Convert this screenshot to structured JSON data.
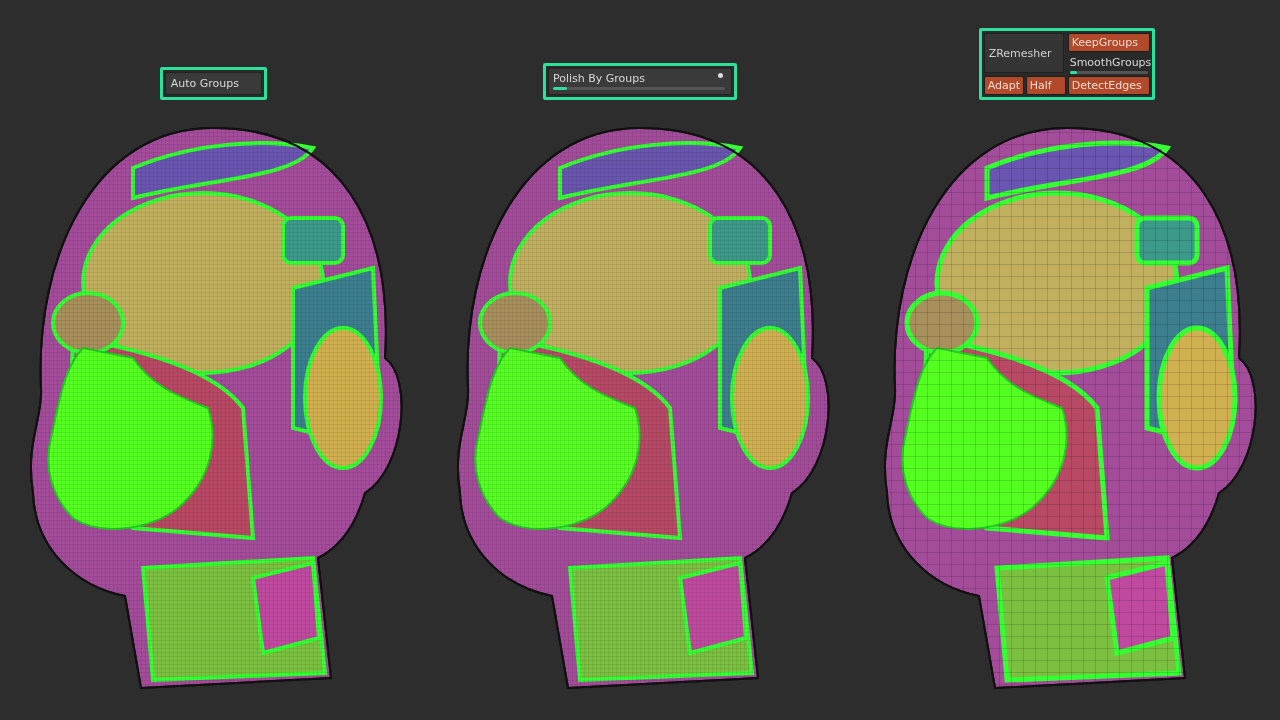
{
  "columns": [
    {
      "panel": {
        "kind": "button",
        "label": "Auto Groups"
      },
      "model": {
        "kind": "dense"
      }
    },
    {
      "panel": {
        "kind": "slider",
        "label": "Polish By Groups",
        "level": 0.08
      },
      "model": {
        "kind": "dense"
      }
    },
    {
      "panel": {
        "kind": "zremesher",
        "label": "ZRemesher",
        "top_button": {
          "label": "KeepGroups",
          "on": true
        },
        "slider": {
          "label": "SmoothGroups",
          "level": 0.1
        },
        "bottom_buttons": [
          {
            "label": "Adapt",
            "on": true
          },
          {
            "label": "Half",
            "on": true
          },
          {
            "label": "DetectEdges",
            "on": true
          }
        ]
      },
      "model": {
        "kind": "remeshed"
      }
    }
  ]
}
